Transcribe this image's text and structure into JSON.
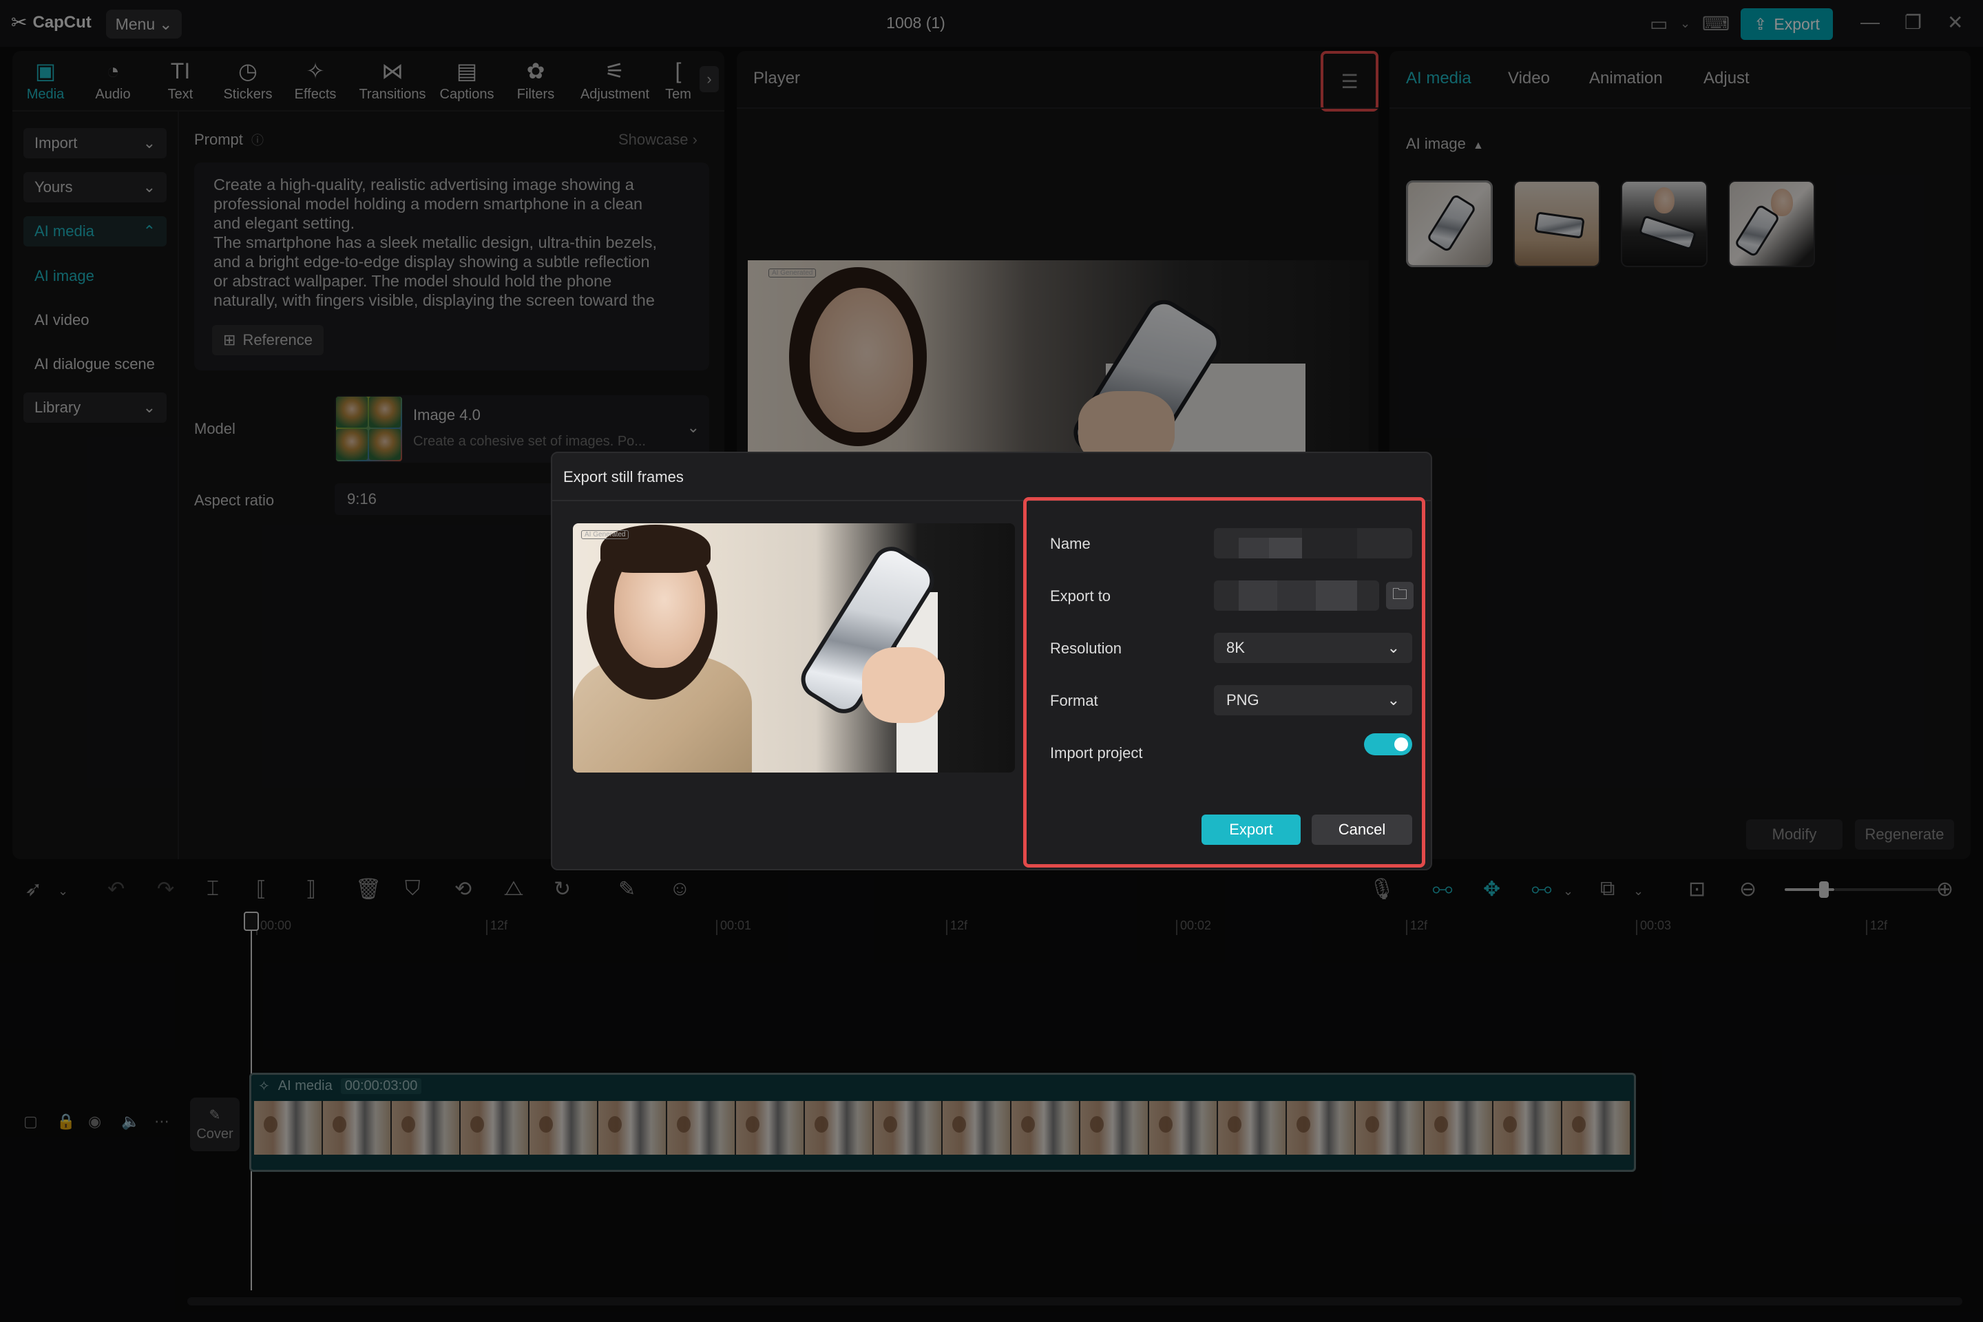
{
  "app": {
    "name": "CapCut",
    "menu_label": "Menu",
    "title": "1008 (1)",
    "export_label": "Export"
  },
  "toolbar": {
    "tabs": [
      {
        "label": "Media",
        "icon": "media-icon",
        "active": true
      },
      {
        "label": "Audio",
        "icon": "audio-icon"
      },
      {
        "label": "Text",
        "icon": "text-icon"
      },
      {
        "label": "Stickers",
        "icon": "stickers-icon"
      },
      {
        "label": "Effects",
        "icon": "effects-icon"
      },
      {
        "label": "Transitions",
        "icon": "transitions-icon"
      },
      {
        "label": "Captions",
        "icon": "captions-icon"
      },
      {
        "label": "Filters",
        "icon": "filters-icon"
      },
      {
        "label": "Adjustment",
        "icon": "adjustment-icon"
      },
      {
        "label": "Tem",
        "icon": "templates-icon"
      }
    ]
  },
  "sidebar": {
    "import": "Import",
    "yours": "Yours",
    "ai_media": "AI media",
    "ai_image": "AI image",
    "ai_video": "AI video",
    "ai_dialogue": "AI dialogue scene",
    "library": "Library"
  },
  "prompt": {
    "label": "Prompt",
    "showcase": "Showcase",
    "text": "Create a high-quality, realistic advertising image showing a\nprofessional model holding a modern smartphone in a clean\nand elegant setting.\nThe smartphone has a sleek metallic design, ultra-thin bezels,\nand a bright edge-to-edge display showing a subtle reflection\nor abstract wallpaper. The model should hold the phone\nnaturally, with fingers visible, displaying the screen toward the",
    "reference": "Reference"
  },
  "model": {
    "label": "Model",
    "name": "Image 4.0",
    "desc": "Create a cohesive set of images. Po..."
  },
  "aspect": {
    "label": "Aspect ratio",
    "value": "9:16"
  },
  "player": {
    "label": "Player",
    "tag": "AI Generated"
  },
  "right_panel": {
    "tabs": [
      "AI media",
      "Video",
      "Animation",
      "Adjust"
    ],
    "section": "AI image",
    "modify": "Modify",
    "regenerate": "Regenerate"
  },
  "dialog": {
    "title": "Export still frames",
    "name_label": "Name",
    "export_to_label": "Export to",
    "resolution_label": "Resolution",
    "resolution_value": "8K",
    "format_label": "Format",
    "format_value": "PNG",
    "import_label": "Import project",
    "import_on": true,
    "export_btn": "Export",
    "cancel_btn": "Cancel",
    "tag": "AI Generated"
  },
  "timeline": {
    "ticks": [
      "00:00",
      "12f",
      "00:01",
      "12f",
      "00:02",
      "12f",
      "00:03",
      "12f"
    ],
    "cover": "Cover",
    "clip_label": "AI media",
    "clip_duration": "00:00:03:00"
  },
  "colors": {
    "accent": "#1fb8c4",
    "highlight": "#e34a4a",
    "background": "#0b0b0c"
  }
}
